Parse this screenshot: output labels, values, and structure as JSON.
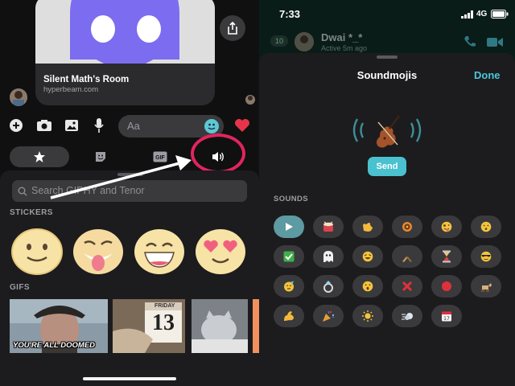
{
  "left": {
    "link_card": {
      "title": "Silent Math's Room",
      "domain": "hyperbeam.com"
    },
    "composer": {
      "placeholder": "Aa",
      "icons": [
        "plus-circle-icon",
        "camera-icon",
        "photo-icon",
        "microphone-icon",
        "emoji-icon",
        "heart-icon"
      ]
    },
    "picker_tabs": [
      "star-icon",
      "sticker-icon",
      "GIF",
      "speaker-icon"
    ],
    "search_placeholder": "Search GIPHY and Tenor",
    "stickers_label": "STICKERS",
    "gifs_label": "GIFS",
    "gif_caption": "YOU'RE ALL DOOMED",
    "gif_calendar": {
      "month": "FRIDAY",
      "day": "13"
    }
  },
  "right": {
    "status": {
      "time": "7:33",
      "network": "4G"
    },
    "chat": {
      "back_count": "10",
      "contact_name": "Dwai *_*",
      "contact_status": "Active 5m ago"
    },
    "panel": {
      "title": "Soundmojis",
      "done": "Done",
      "send": "Send",
      "sounds_label": "SOUNDS"
    },
    "sounds": [
      [
        "play",
        "drum",
        "clap",
        "hole",
        "zany",
        "hush"
      ],
      [
        "check",
        "ghost",
        "laugh",
        "cheers",
        "hourglass",
        "cool"
      ],
      [
        "party-face",
        "ring",
        "surprised",
        "cross",
        "red-circle",
        "goat"
      ],
      [
        "flex",
        "popper",
        "sun",
        "dash",
        "calendar"
      ]
    ],
    "colors": {
      "accent": "#4cc6db",
      "highlight": "#e1245f"
    }
  }
}
